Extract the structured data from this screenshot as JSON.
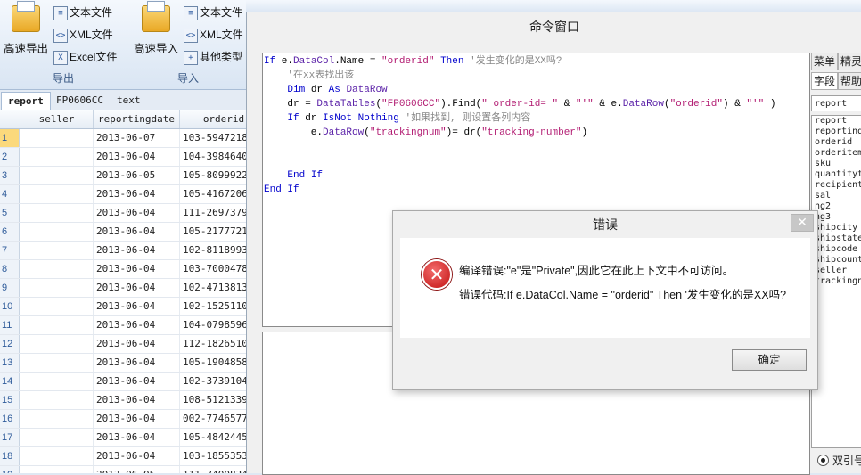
{
  "ribbon": {
    "export_group": {
      "title": "导出",
      "big_button": "高速导出",
      "items": [
        "文本文件",
        "XML文件",
        "Excel文件"
      ]
    },
    "import_group": {
      "title": "导入",
      "big_button": "高速导入",
      "items": [
        "文本文件",
        "XML文件",
        "其他类型"
      ]
    }
  },
  "tabs": [
    "report",
    "FP0606CC",
    "text"
  ],
  "grid": {
    "columns": [
      "seller",
      "reportingdate",
      "orderid"
    ],
    "rows": [
      {
        "n": "1",
        "seller": "",
        "date": "2013-06-07",
        "orderid": "103-5947218"
      },
      {
        "n": "2",
        "seller": "",
        "date": "2013-06-04",
        "orderid": "104-3984640"
      },
      {
        "n": "3",
        "seller": "",
        "date": "2013-06-05",
        "orderid": "105-8099922"
      },
      {
        "n": "4",
        "seller": "",
        "date": "2013-06-04",
        "orderid": "105-4167206"
      },
      {
        "n": "5",
        "seller": "",
        "date": "2013-06-04",
        "orderid": "111-2697379"
      },
      {
        "n": "6",
        "seller": "",
        "date": "2013-06-04",
        "orderid": "105-2177721"
      },
      {
        "n": "7",
        "seller": "",
        "date": "2013-06-04",
        "orderid": "102-8118993"
      },
      {
        "n": "8",
        "seller": "",
        "date": "2013-06-04",
        "orderid": "103-7000478"
      },
      {
        "n": "9",
        "seller": "",
        "date": "2013-06-04",
        "orderid": "102-4713813"
      },
      {
        "n": "10",
        "seller": "",
        "date": "2013-06-04",
        "orderid": "102-1525110"
      },
      {
        "n": "11",
        "seller": "",
        "date": "2013-06-04",
        "orderid": "104-0798596"
      },
      {
        "n": "12",
        "seller": "",
        "date": "2013-06-04",
        "orderid": "112-1826510"
      },
      {
        "n": "13",
        "seller": "",
        "date": "2013-06-04",
        "orderid": "105-1904858"
      },
      {
        "n": "14",
        "seller": "",
        "date": "2013-06-04",
        "orderid": "102-3739104"
      },
      {
        "n": "15",
        "seller": "",
        "date": "2013-06-04",
        "orderid": "108-5121339"
      },
      {
        "n": "16",
        "seller": "",
        "date": "2013-06-04",
        "orderid": "002-7746577"
      },
      {
        "n": "17",
        "seller": "",
        "date": "2013-06-04",
        "orderid": "105-4842445"
      },
      {
        "n": "18",
        "seller": "",
        "date": "2013-06-04",
        "orderid": "103-1855353"
      },
      {
        "n": "19",
        "seller": "",
        "date": "2013-06-05",
        "orderid": "111-7400834"
      }
    ]
  },
  "command_window": {
    "title": "命令窗口",
    "code_lines": [
      "If e.DataCol.Name = \"orderid\" Then '发生变化的是XX吗?",
      "    '在xx表找出该",
      "    Dim dr As DataRow",
      "    dr = DataTables(\"FP0606CC\").Find(\" order-id= \" & \"'\" & e.DataRow(\"orderid\") & \"'\" )",
      "    If dr IsNot Nothing '如果找到, 则设置各列内容",
      "        e.DataRow(\"trackingnum\")= dr(\"tracking-number\")",
      "",
      "",
      "    End If",
      "End If"
    ],
    "side_tabs": [
      "菜单",
      "精灵",
      "字段",
      "帮助"
    ],
    "field_table": "report",
    "fields": [
      "report",
      "reporting",
      "orderid",
      "orderitem",
      "sku",
      "quantityt",
      "recipient",
      "sal",
      "ng2",
      "ng3",
      "shipcity",
      "shipstate",
      "shipcode",
      "shipcount",
      "seller",
      "trackingn"
    ],
    "radio_label": "双引号"
  },
  "error_dialog": {
    "title": "错误",
    "close_glyph": "✕",
    "message": "编译错误:\"e\"是\"Private\",因此它在此上下文中不可访问。",
    "code_detail": "错误代码:If e.DataCol.Name = \"orderid\" Then '发生变化的是XX吗?",
    "ok_label": "确定"
  }
}
